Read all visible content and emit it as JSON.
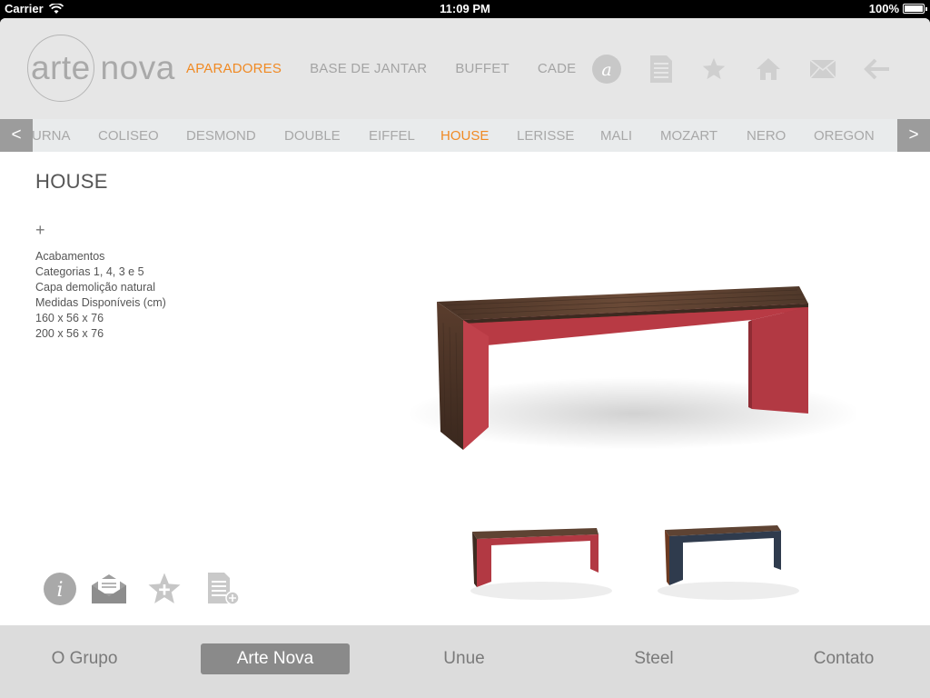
{
  "status": {
    "carrier": "Carrier",
    "time": "11:09 PM",
    "battery": "100%",
    "battery_level": 1.0
  },
  "brand": {
    "logo_text": "arte nova"
  },
  "topnav": {
    "items": [
      "APARADORES",
      "BASE DE JANTAR",
      "BUFFET",
      "CADE"
    ],
    "active_index": 0
  },
  "header_icons": [
    "a-logo-icon",
    "document-icon",
    "star-icon",
    "home-icon",
    "mail-icon",
    "back-arrow-icon"
  ],
  "subnav": {
    "prev_label": "<",
    "next_label": ">",
    "items": [
      "URNA",
      "COLISEO",
      "DESMOND",
      "DOUBLE",
      "EIFFEL",
      "HOUSE",
      "LERISSE",
      "MALI",
      "MOZART",
      "NERO",
      "OREGON"
    ],
    "active": "HOUSE"
  },
  "product": {
    "title": "HOUSE",
    "expand_symbol": "+",
    "specs": [
      "Acabamentos",
      "Categorias 1, 4, 3 e 5",
      "Capa demolição natural",
      "Medidas Disponíveis (cm)",
      "160 x 56 x 76",
      "200 x 56 x 76"
    ]
  },
  "actions": [
    "info-icon",
    "email-icon",
    "add-favorite-icon",
    "add-document-icon"
  ],
  "tabs": {
    "items": [
      "O Grupo",
      "Arte Nova",
      "Unue",
      "Steel",
      "Contato"
    ],
    "active_index": 1
  },
  "colors": {
    "accent": "#f08a24",
    "bench_red": "#b93a43",
    "bench_blue": "#2f3b4d",
    "wood": "#5b3f2e"
  }
}
